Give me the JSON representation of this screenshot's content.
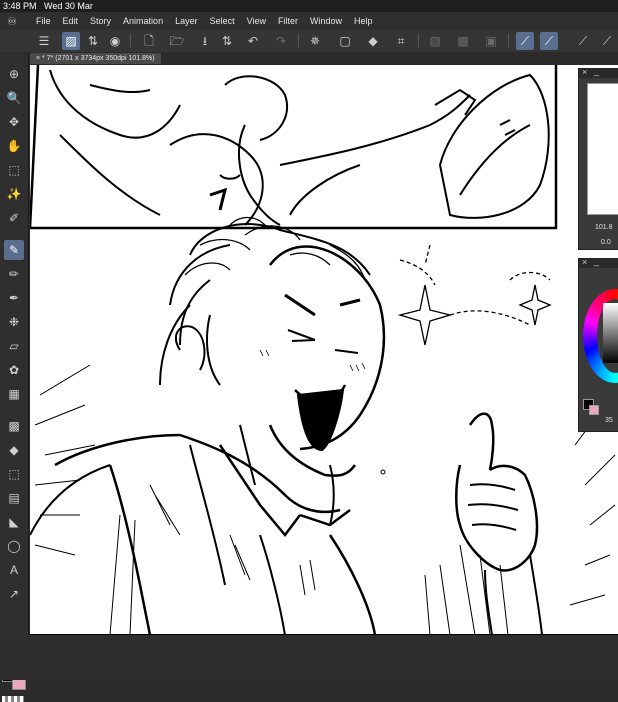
{
  "status": {
    "time": "3:48 PM",
    "date": "Wed 30 Mar"
  },
  "menu": [
    "File",
    "Edit",
    "Story",
    "Animation",
    "Layer",
    "Select",
    "View",
    "Filter",
    "Window",
    "Help"
  ],
  "document_tab": "* 7* (2701 x 3734px 350dpi 101.8%)",
  "navigator": {
    "zoom": "101.8",
    "angle": "0.0"
  },
  "color_panel": {
    "value_label": "35"
  },
  "colors": {
    "main": "#000000",
    "sub": "#e8a9c0",
    "accent": "#5a6f8f"
  }
}
